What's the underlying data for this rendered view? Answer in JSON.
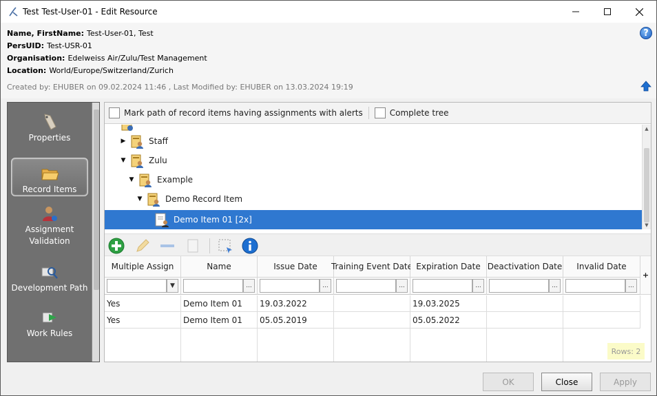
{
  "window": {
    "title": "Test Test-User-01 - Edit Resource"
  },
  "header": {
    "name_label": "Name, FirstName:",
    "name_value": "Test-User-01, Test",
    "persuid_label": "PersUID:",
    "persuid_value": "Test-USR-01",
    "org_label": "Organisation:",
    "org_value": "Edelweiss Air/Zulu/Test Management",
    "location_label": "Location:",
    "location_value": "World/Europe/Switzerland/Zurich",
    "created": "Created by: EHUBER on 09.02.2024 11:46 ,  Last Modified by: EHUBER on 13.03.2024 19:19"
  },
  "nav": {
    "items": [
      {
        "label": "Properties",
        "icon": "tag-icon"
      },
      {
        "label": "Record Items",
        "icon": "folder-icon",
        "active": true
      },
      {
        "label": "Assignment Validation",
        "icon": "user-validation-icon"
      },
      {
        "label": "Development Path",
        "icon": "search-user-icon"
      },
      {
        "label": "Work Rules",
        "icon": "rules-icon"
      }
    ]
  },
  "options": {
    "mark_path_label": "Mark path of record items having assignments with alerts",
    "complete_tree_label": "Complete tree"
  },
  "tree": {
    "items": [
      {
        "label": "Staff",
        "expanded": false
      },
      {
        "label": "Zulu",
        "expanded": true
      },
      {
        "label": "Example",
        "expanded": true
      },
      {
        "label": "Demo Record Item",
        "expanded": true
      },
      {
        "label": "Demo Item 01 [2x]",
        "selected": true
      }
    ]
  },
  "grid": {
    "columns": [
      "Multiple Assign",
      "Name",
      "Issue Date",
      "Training Event Date",
      "Expiration Date",
      "Deactivation Date",
      "Invalid Date"
    ],
    "rows": [
      [
        "Yes",
        "Demo Item 01",
        "19.03.2022",
        "",
        "19.03.2025",
        "",
        ""
      ],
      [
        "Yes",
        "Demo Item 01",
        "05.05.2019",
        "",
        "05.05.2022",
        "",
        ""
      ]
    ],
    "add_column": "+",
    "rows_count": "Rows: 2",
    "filter_button": "...",
    "dropdown_arrow": "▼"
  },
  "buttons": {
    "ok": "OK",
    "close": "Close",
    "apply": "Apply"
  },
  "colors": {
    "selection": "#2f78d0",
    "nav_bg": "#707070",
    "rows_badge_bg": "#fbfbc8"
  }
}
